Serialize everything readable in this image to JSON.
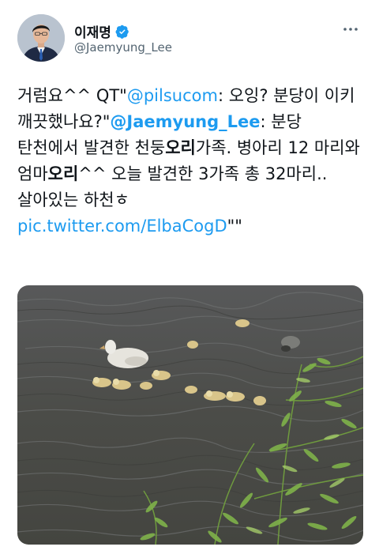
{
  "author": {
    "display_name": "이재명",
    "handle": "@Jaemyung_Lee",
    "verified": true,
    "avatar_icon": "profile-photo"
  },
  "more_icon": "more-dots-icon",
  "tweet": {
    "parts": {
      "p1": "거럼요^^ QT\"",
      "link1": "@pilsucom",
      "p2": ": 오잉? 분당이 이키 깨끗했나요?\"",
      "mention": "@Jaemyung_Lee",
      "p3": ": 분당 탄천에서 발견한 천둥",
      "hl1": "오리",
      "p4": "가족. 병아리 12 마리와 엄마",
      "hl2": "오리",
      "p5": "^^ 오늘 발견한 3가족 총 32마리..살아있는 하천ㅎ",
      "link2": "pic.twitter.com/ElbaCogD",
      "p6": "\"\""
    }
  },
  "media": {
    "kind": "photo",
    "subject": "duck family swimming in stream with willow branches"
  },
  "colors": {
    "link": "#1d9bf0",
    "verified": "#1d9bf0",
    "secondary_text": "#536471",
    "water": "#4c4d47"
  }
}
